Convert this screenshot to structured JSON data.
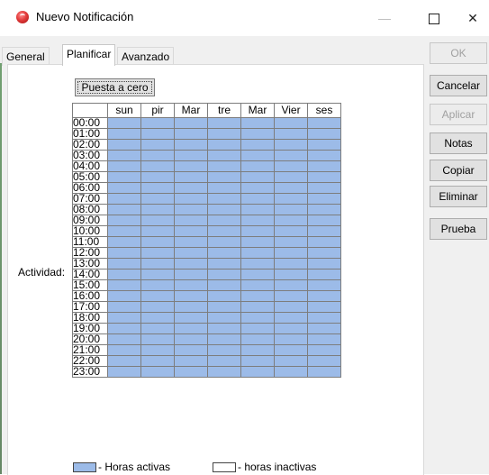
{
  "window": {
    "title": "Nuevo Notificación",
    "controls": {
      "minimize": "—",
      "close": "✕"
    }
  },
  "tabs": [
    {
      "label": "General"
    },
    {
      "label": "Planificar"
    },
    {
      "label": "Avanzado"
    }
  ],
  "schedule": {
    "reset_button": "Puesta a cero",
    "activity_label": "Actividad:",
    "days": [
      "sun",
      "pir",
      "Mar",
      "tre",
      "Mar",
      "Vier",
      "ses"
    ],
    "hours": [
      "00:00",
      "01:00",
      "02:00",
      "03:00",
      "04:00",
      "05:00",
      "06:00",
      "07:00",
      "08:00",
      "09:00",
      "10:00",
      "11:00",
      "12:00",
      "13:00",
      "14:00",
      "15:00",
      "16:00",
      "17:00",
      "18:00",
      "19:00",
      "20:00",
      "21:00",
      "22:00",
      "23:00"
    ],
    "active_color": "#9cbbe8",
    "legend": {
      "active": "- Horas activas",
      "inactive": "- horas inactivas"
    }
  },
  "actions": {
    "ok": "OK",
    "cancel": "Cancelar",
    "apply": "Aplicar",
    "notes": "Notas",
    "copy": "Copiar",
    "delete": "Eliminar",
    "test": "Prueba"
  }
}
